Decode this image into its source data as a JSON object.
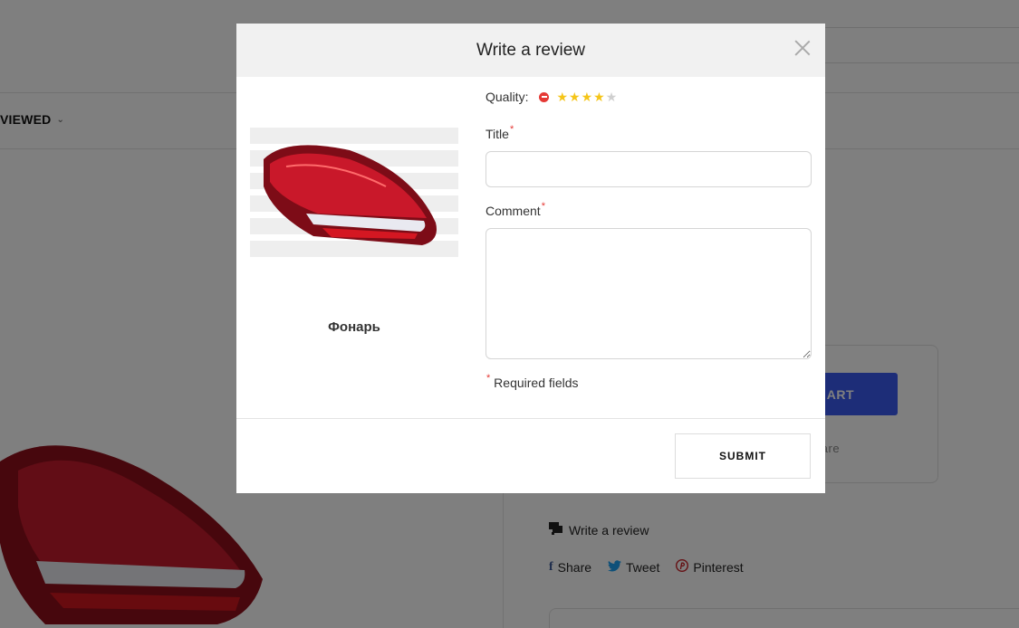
{
  "background": {
    "viewed_label": "VIEWED",
    "cart_button_label": "ART",
    "compare_label": "ompare",
    "write_review_label": "Write a review",
    "share_label": "Share",
    "tweet_label": "Tweet",
    "pinterest_label": "Pinterest"
  },
  "modal": {
    "title": "Write a review",
    "product_name": "Фонарь",
    "quality_label": "Quality:",
    "rating": {
      "value": 4,
      "max": 5
    },
    "title_label": "Title",
    "title_value": "",
    "comment_label": "Comment",
    "comment_value": "",
    "required_asterisk": "*",
    "required_note": "Required fields",
    "submit_label": "SUBMIT"
  },
  "colors": {
    "overlay": "rgba(0,0,0,0.5)",
    "accent_blue": "#3b5bf0",
    "star": "#f5c518",
    "required": "#e53935"
  }
}
